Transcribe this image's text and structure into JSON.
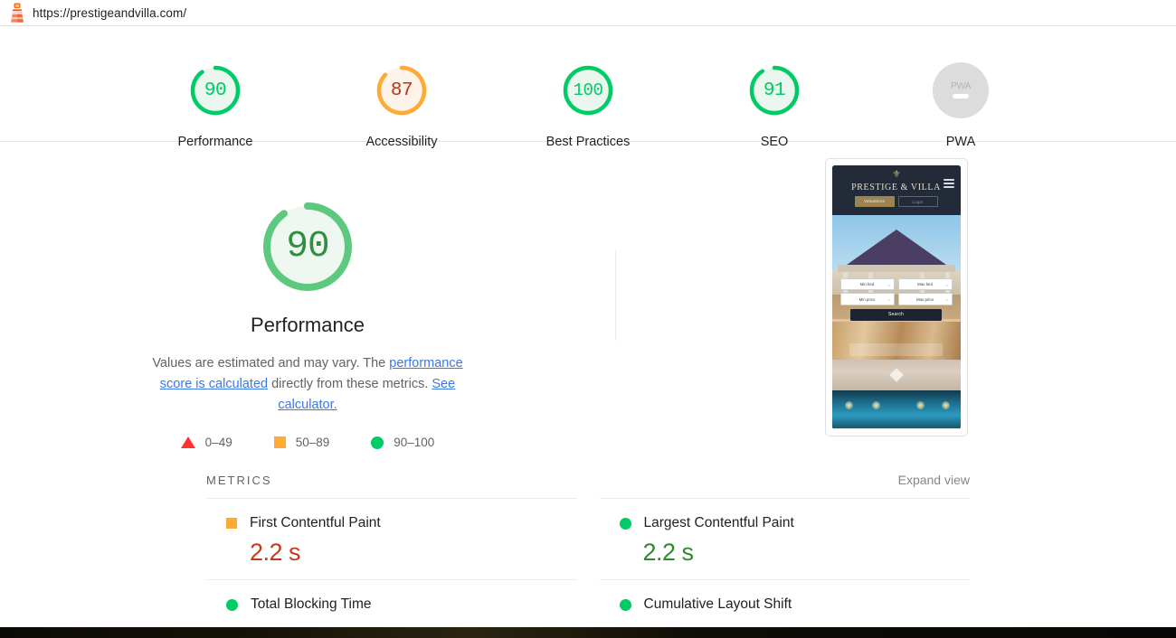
{
  "urlbar": {
    "icon": "lighthouse-icon",
    "url": "https://prestigeandvilla.com/"
  },
  "score_strip": {
    "items": [
      {
        "label": "Performance",
        "score": "90",
        "color": "#0c6",
        "track": "#eaf6ee",
        "type": "gauge"
      },
      {
        "label": "Accessibility",
        "score": "87",
        "color": "#fa3",
        "track": "#fdf3e8",
        "type": "gauge"
      },
      {
        "label": "Best Practices",
        "score": "100",
        "color": "#0c6",
        "track": "#eaf6ee",
        "type": "gauge"
      },
      {
        "label": "SEO",
        "score": "91",
        "color": "#0c6",
        "track": "#eaf6ee",
        "type": "gauge"
      },
      {
        "label": "PWA",
        "score": "PWA",
        "color": "#dcdcdc",
        "type": "badge"
      }
    ]
  },
  "hero": {
    "gauge": {
      "score": "90",
      "color": "#0c6"
    },
    "category_title": "Performance",
    "description": {
      "part1": "Values are estimated and may vary. The ",
      "link1": "performance score is calculated",
      "part2": " directly from these metrics. ",
      "link2": "See calculator."
    },
    "legend": [
      {
        "shape": "triangle",
        "color": "#f33",
        "range": "0–49"
      },
      {
        "shape": "square",
        "color": "#fa3",
        "range": "50–89"
      },
      {
        "shape": "circle",
        "color": "#0c6",
        "range": "90–100"
      }
    ]
  },
  "screenshot_thumbnail": {
    "brand": "PRESTIGE & VILLA",
    "crest": "⚜",
    "nav_buttons": [
      "Valuations",
      "Login"
    ],
    "menu_icon": "hamburger-icon",
    "search_form": {
      "fields": [
        "Min bed",
        "Max bed",
        "Min price",
        "Max price"
      ],
      "chevron": "⌄",
      "submit": "Search"
    }
  },
  "metrics": {
    "title": "METRICS",
    "expand_label": "Expand view",
    "rows": [
      {
        "name": "First Contentful Paint",
        "value": "2.2 s",
        "bullet": "square",
        "value_color": "red"
      },
      {
        "name": "Largest Contentful Paint",
        "value": "2.2 s",
        "bullet": "circle",
        "value_color": "green"
      },
      {
        "name": "Total Blocking Time",
        "value": "",
        "bullet": "circle",
        "value_color": "green"
      },
      {
        "name": "Cumulative Layout Shift",
        "value": "",
        "bullet": "circle",
        "value_color": "green"
      }
    ]
  }
}
